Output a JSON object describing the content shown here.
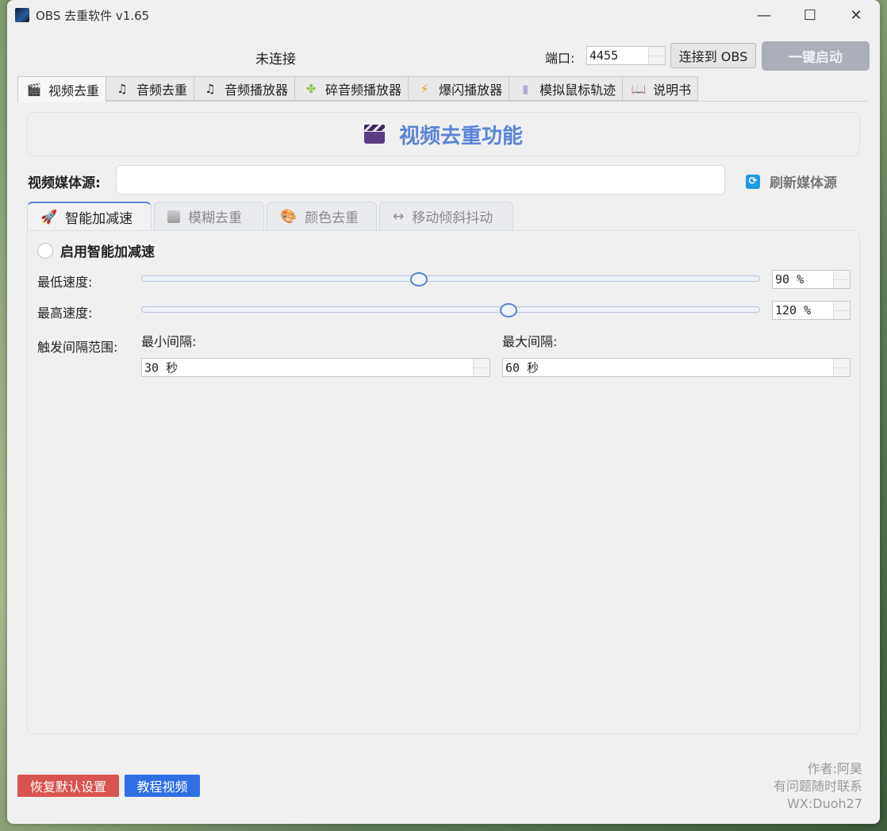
{
  "window": {
    "title": "OBS 去重软件 v1.65",
    "minimize": "—",
    "maximize": "☐",
    "close": "✕"
  },
  "header": {
    "status": "未连接",
    "port_label": "端口:",
    "port_value": "4455",
    "connect_button": "连接到 OBS",
    "start_button": "一键启动"
  },
  "tabs": [
    {
      "label": "视频去重",
      "icon": "clapper-icon"
    },
    {
      "label": "音频去重",
      "icon": "music-note-icon"
    },
    {
      "label": "音频播放器",
      "icon": "music-note-icon"
    },
    {
      "label": "碎音频播放器",
      "icon": "puzzle-icon"
    },
    {
      "label": "爆闪播放器",
      "icon": "lightning-icon"
    },
    {
      "label": "模拟鼠标轨迹",
      "icon": "mouse-icon"
    },
    {
      "label": "说明书",
      "icon": "book-icon"
    }
  ],
  "panel": {
    "title": "视频去重功能",
    "source_label": "视频媒体源:",
    "source_value": "",
    "refresh_button": "刷新媒体源"
  },
  "subtabs": [
    {
      "label": "智能加减速",
      "icon": "rocket-icon"
    },
    {
      "label": "模糊去重",
      "icon": "image-icon"
    },
    {
      "label": "颜色去重",
      "icon": "palette-icon"
    },
    {
      "label": "移动倾斜抖动",
      "icon": "arrows-icon"
    }
  ],
  "speed": {
    "enable_label": "启用智能加减速",
    "enabled": false,
    "min_label": "最低速度:",
    "min_value": "90 %",
    "min_slider": 0.45,
    "max_label": "最高速度:",
    "max_value": "120 %",
    "max_slider": 0.595,
    "interval_label": "触发间隔范围:",
    "min_interval_label": "最小间隔:",
    "min_interval_value": "30 秒",
    "max_interval_label": "最大间隔:",
    "max_interval_value": "60 秒"
  },
  "footer": {
    "reset_button": "恢复默认设置",
    "reset_color": "#d9534f",
    "tutorial_button": "教程视频",
    "tutorial_color": "#2f6fe4",
    "author": "作者:阿昊",
    "contact": "有问题随时联系",
    "wx": "WX:Duoh27"
  },
  "colors": {
    "accent": "#5a84d6",
    "start_button_bg": "#a9aeb8"
  }
}
